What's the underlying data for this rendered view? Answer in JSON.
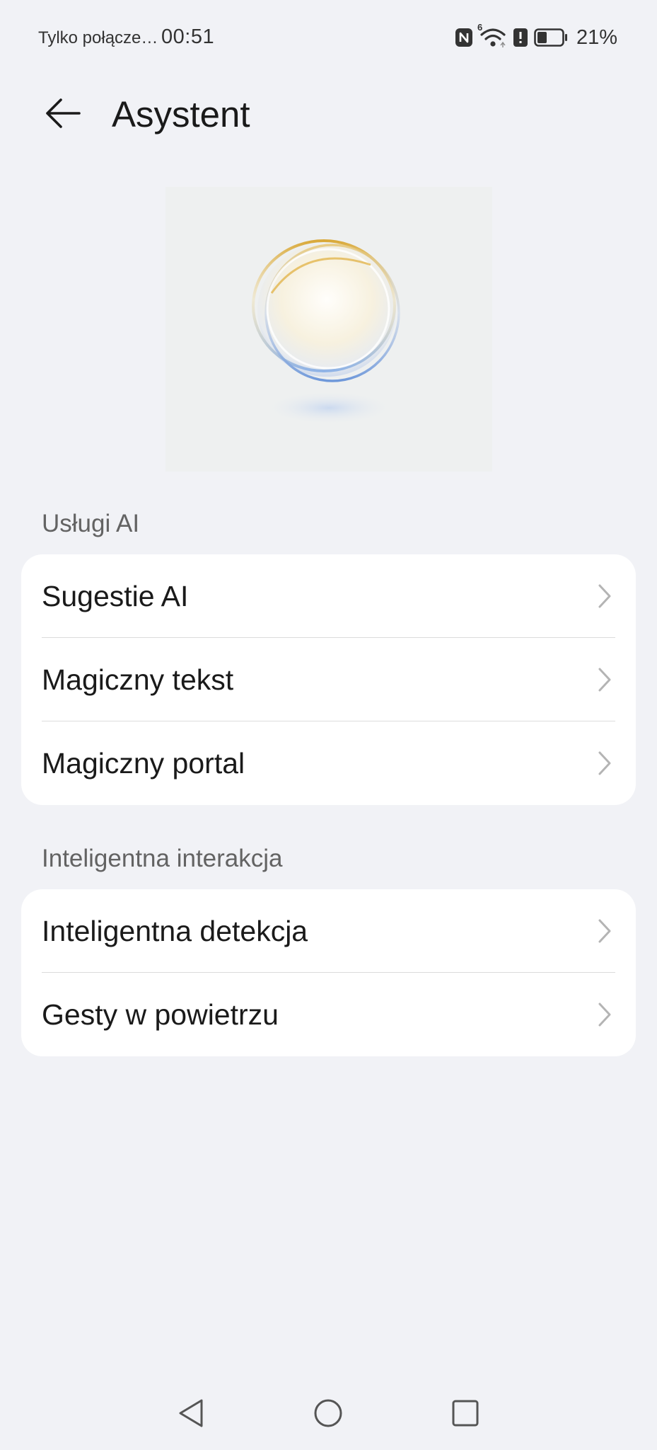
{
  "status_bar": {
    "carrier": "Tylko połącze…",
    "time": "00:51",
    "signal_label": "6",
    "battery_percent": "21%",
    "battery_level": 0.21,
    "icons": [
      "nfc-icon",
      "wifi-icon",
      "alert-icon",
      "battery-icon"
    ]
  },
  "header": {
    "title": "Asystent",
    "back_icon": "arrow-left-icon"
  },
  "sections": [
    {
      "title": "Usługi AI",
      "items": [
        {
          "label": "Sugestie AI"
        },
        {
          "label": "Magiczny tekst"
        },
        {
          "label": "Magiczny portal"
        }
      ]
    },
    {
      "title": "Inteligentna interakcja",
      "items": [
        {
          "label": "Inteligentna detekcja"
        },
        {
          "label": "Gesty w powietrzu"
        }
      ]
    }
  ],
  "nav": {
    "icons": [
      "back-triangle-icon",
      "home-circle-icon",
      "recents-square-icon"
    ]
  },
  "colors": {
    "background": "#f1f2f6",
    "card": "#ffffff",
    "text_primary": "#1a1a1a",
    "text_section": "#636363",
    "chevron": "#b4b4b4"
  }
}
